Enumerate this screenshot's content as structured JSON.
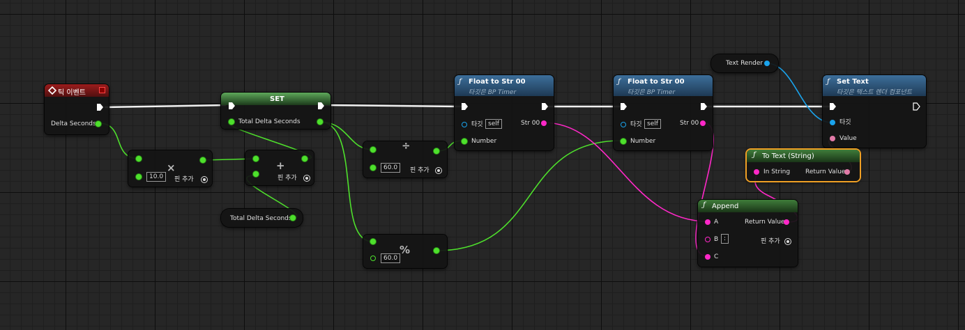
{
  "tick_event": {
    "title": "틱 이벤트",
    "delta_label": "Delta Seconds"
  },
  "set_node": {
    "title": "SET",
    "var_label": "Total Delta Seconds"
  },
  "multiply_node": {
    "op": "×",
    "value": "10.0",
    "add_pin": "핀 추가"
  },
  "add_node": {
    "op": "+",
    "add_pin": "핀 추가"
  },
  "getter_node": {
    "label": "Total Delta Seconds"
  },
  "divide_node": {
    "op": "÷",
    "value": "60.0",
    "add_pin": "핀 추가"
  },
  "modulo_node": {
    "op": "%",
    "value": "60.0"
  },
  "float_to_str_1": {
    "title": "Float to Str 00",
    "subtitle": "타깃은 BP Timer",
    "target_label": "타깃",
    "target_value": "self",
    "output_label": "Str 00",
    "number_label": "Number"
  },
  "float_to_str_2": {
    "title": "Float to Str 00",
    "subtitle": "타깃은 BP Timer",
    "target_label": "타깃",
    "target_value": "self",
    "output_label": "Str 00",
    "number_label": "Number"
  },
  "text_render": {
    "label": "Text Render"
  },
  "set_text": {
    "title": "Set Text",
    "subtitle": "타깃은 텍스트 렌더 컴포넌트",
    "target_label": "타깃",
    "value_label": "Value"
  },
  "to_text": {
    "title": "To Text (String)",
    "input_label": "In String",
    "output_label": "Return Value"
  },
  "append": {
    "title": "Append",
    "a_label": "A",
    "b_label": "B",
    "b_value": ":",
    "c_label": "C",
    "output_label": "Return Value",
    "add_pin": "핀 추가"
  },
  "colors": {
    "float_pin": "#4ee02c",
    "string_pin": "#ff28c8",
    "object_pin": "#1aa3ec",
    "text_pin": "#e27aa8",
    "exec_wire": "#ffffff",
    "selection": "#f0a024"
  }
}
